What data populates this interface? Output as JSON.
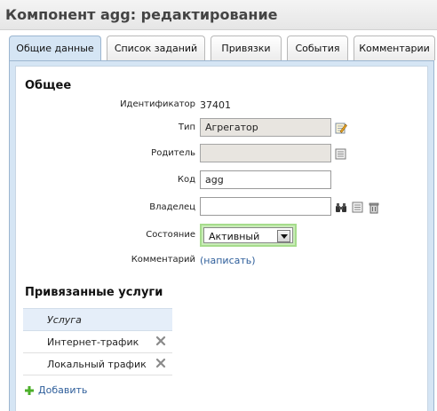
{
  "header": {
    "title": "Компонент agg: редактирование"
  },
  "tabs": [
    {
      "label": "Общие данные",
      "active": true
    },
    {
      "label": "Список заданий",
      "active": false
    },
    {
      "label": "Привязки",
      "active": false
    },
    {
      "label": "События",
      "active": false
    },
    {
      "label": "Комментарии",
      "active": false
    }
  ],
  "general": {
    "title": "Общее",
    "id_label": "Идентификатор",
    "id_value": "37401",
    "type_label": "Тип",
    "type_value": "Агрегатор",
    "parent_label": "Родитель",
    "parent_value": "",
    "code_label": "Код",
    "code_value": "agg",
    "owner_label": "Владелец",
    "owner_value": "",
    "state_label": "Состояние",
    "state_value": "Активный",
    "comment_label": "Комментарий",
    "comment_link": "(написать)"
  },
  "services": {
    "title": "Привязанные услуги",
    "column": "Услуга",
    "rows": [
      "Интернет-трафик",
      "Локальный трафик"
    ],
    "add_label": "Добавить"
  },
  "colors": {
    "active_tab": "#d5e5f4",
    "link": "#2f5f9b",
    "state_highlight": "#c9ecb8",
    "add_icon": "#4caf2a"
  }
}
